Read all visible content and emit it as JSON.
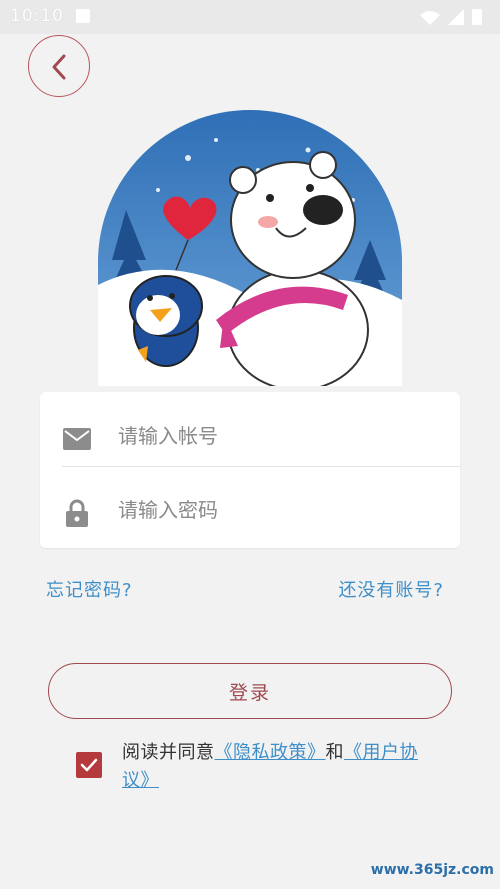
{
  "status_bar": {
    "time": "10:10"
  },
  "header": {
    "back_icon": "chevron-left-icon"
  },
  "hero": {
    "image": "polar-bear-and-penguin-illustration"
  },
  "form": {
    "account": {
      "icon": "mail-icon",
      "placeholder": "请输入帐号",
      "value": ""
    },
    "password": {
      "icon": "lock-icon",
      "placeholder": "请输入密码",
      "value": ""
    }
  },
  "links": {
    "forgot_password": "忘记密码?",
    "no_account": "还没有账号?"
  },
  "login_button": {
    "label": "登录"
  },
  "agreement": {
    "checked": true,
    "prefix": "阅读并同意",
    "privacy_policy": "《隐私政策》",
    "conjunction": "和",
    "user_agreement": "《用户协议》"
  },
  "watermark": {
    "text": "www.365jz.com"
  },
  "colors": {
    "accent": "#a04a50",
    "checkbox": "#b43a3e",
    "link": "#3e8fc9",
    "background": "#f2f2f2"
  }
}
